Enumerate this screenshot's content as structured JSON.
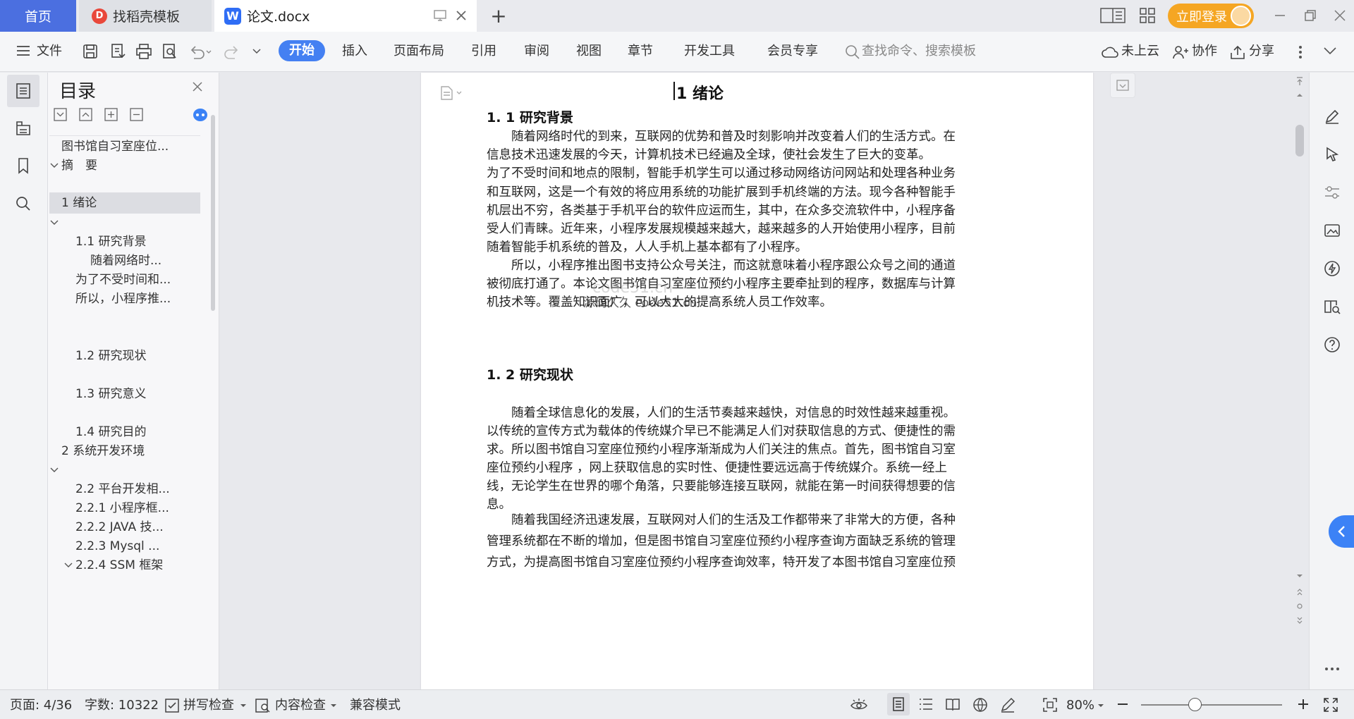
{
  "tabs": {
    "home": "首页",
    "template": "找稻壳模板",
    "doc": "论文.docx",
    "login": "立即登录"
  },
  "menu": {
    "file": "文件",
    "start": "开始",
    "items": [
      "插入",
      "页面布局",
      "引用",
      "审阅",
      "视图",
      "章节",
      "开发工具",
      "会员专享"
    ],
    "search_placeholder": "查找命令、搜索模板",
    "cloud": "未上云",
    "collab": "协作",
    "share": "分享"
  },
  "toc": {
    "title": "目录",
    "items": [
      {
        "text": "图书馆自习室座位...",
        "indent": 0,
        "chev": false,
        "selected": false
      },
      {
        "text": "摘　要",
        "indent": 0,
        "chev": true,
        "selected": false
      },
      {
        "text": "1  绪论",
        "indent": 0,
        "chev": false,
        "selected": true
      },
      {
        "text": "",
        "indent": 0,
        "chev": true,
        "selected": false
      },
      {
        "text": "1.1 研究背景",
        "indent": 1,
        "chev": false,
        "selected": false
      },
      {
        "text": "随着网络时...",
        "indent": 2,
        "chev": false,
        "selected": false
      },
      {
        "text": "为了不受时间和...",
        "indent": 1,
        "chev": false,
        "selected": false
      },
      {
        "text": "所以，小程序推...",
        "indent": 1,
        "chev": false,
        "selected": false
      },
      {
        "text": "1.2 研究现状",
        "indent": 1,
        "chev": false,
        "selected": false
      },
      {
        "text": "1.3  研究意义",
        "indent": 1,
        "chev": false,
        "selected": false
      },
      {
        "text": "1.4 研究目的",
        "indent": 1,
        "chev": false,
        "selected": false
      },
      {
        "text": "2  系统开发环境",
        "indent": 0,
        "chev": false,
        "selected": false
      },
      {
        "text": "",
        "indent": 0,
        "chev": true,
        "selected": false
      },
      {
        "text": "2.2  平台开发相...",
        "indent": 1,
        "chev": false,
        "selected": false
      },
      {
        "text": "2.2.1 小程序框...",
        "indent": 1,
        "chev": false,
        "selected": false
      },
      {
        "text": "2.2.2 JAVA 技...",
        "indent": 1,
        "chev": false,
        "selected": false
      },
      {
        "text": "2.2.3    Mysql ...",
        "indent": 1,
        "chev": false,
        "selected": false
      },
      {
        "text": "2.2.4 SSM 框架",
        "indent": 1,
        "chev": true,
        "selected": false
      }
    ]
  },
  "doc": {
    "chapter_title": "1  绪论",
    "h_1_1": "1. 1 研究背景",
    "p1": [
      "　　随着网络时代的到来，互联网的优势和普及时刻影响并改变着人们的生活方式。在",
      "信息技术迅速发展的今天，计算机技术已经遍及全球，使社会发生了巨大的变革。"
    ],
    "p2": [
      "为了不受时间和地点的限制，智能手机学生可以通过移动网络访问网站和处理各种业务",
      "和互联网，这是一个有效的将应用系统的功能扩展到手机终端的方法。现今各种智能手",
      "机层出不穷，各类基于手机平台的软件应运而生，其中，在众多交流软件中，小程序备",
      "受人们青睐。近年来，小程序发展规模越来越大，越来越多的人开始使用小程序，目前",
      "随着智能手机系统的普及，人人手机上基本都有了小程序。"
    ],
    "p3": [
      "　　所以，小程序推出图书支持公众号关注，而这就意味着小程序跟公众号之间的通道",
      "被彻底打通了。本论文图书馆自习室座位预约小程序主要牵扯到的程序，数据库与计算",
      "机技术等。覆盖知识面广，可以大大的提高系统人员工作效率。"
    ],
    "watermark1": "code51.cn",
    "watermark2": "源码久久  code51.cn",
    "h_1_2": "1. 2 研究现状",
    "p4": [
      "　　随着全球信息化的发展，人们的生活节奏越来越快，对信息的时效性越来越重视。",
      "以传统的宣传方式为载体的传统媒介早已不能满足人们对获取信息的方式、便捷性的需",
      "求。所以图书馆自习室座位预约小程序渐渐成为人们关注的焦点。首先，图书馆自习室",
      "座位预约小程序  ，网上获取信息的实时性、便捷性要远远高于传统媒介。系统一经上",
      "线，无论学生在世界的哪个角落，只要能够连接互联网，就能在第一时间获得想要的信",
      "息。"
    ],
    "p5": [
      "　　随着我国经济迅速发展，互联网对人们的生活及工作都带来了非常大的方便，各种",
      "管理系统都在不断的增加，但是图书馆自习室座位预约小程序查询方面缺乏系统的管理",
      "方式，为提高图书馆自习室座位预约小程序查询效率，特开发了本图书馆自习室座位预"
    ]
  },
  "status": {
    "page": "页面: 4/36",
    "words": "字数: 10322",
    "spell": "拼写检查",
    "content_check": "内容检查",
    "compat": "兼容模式",
    "zoom": "80%"
  }
}
